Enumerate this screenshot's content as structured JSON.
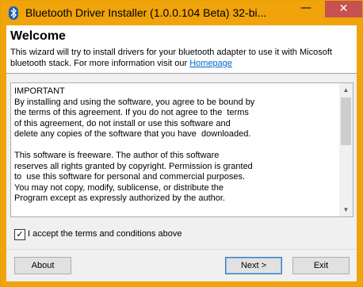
{
  "window": {
    "title": "Bluetooth Driver Installer (1.0.0.104 Beta) 32-bi...",
    "minimize_glyph": "—",
    "close_glyph": "✕"
  },
  "header": {
    "heading": "Welcome",
    "description": "This wizard will try to install drivers for your bluetooth adapter to use it with Micosoft bluetooth stack.  For more information visit our ",
    "homepage_link": "Homepage"
  },
  "license": {
    "text": "IMPORTANT\nBy installing and using the software, you agree to be bound by\nthe terms of this agreement. If you do not agree to the  terms\nof this agreement, do not install or use this software and\ndelete any copies of the software that you have  downloaded.\n\nThis software is freeware. The author of this software\nreserves all rights granted by copyright. Permission is granted\nto  use this software for personal and commercial purposes.\nYou may not copy, modify, sublicense, or distribute the\nProgram except as expressly authorized by the author."
  },
  "accept": {
    "checked": true,
    "check_glyph": "✓",
    "label": "I accept the terms and conditions above"
  },
  "buttons": {
    "about": "About",
    "next": "Next >",
    "exit": "Exit"
  },
  "colors": {
    "titlebar": "#f0a30a",
    "close_button": "#c75050",
    "link": "#0066cc"
  }
}
